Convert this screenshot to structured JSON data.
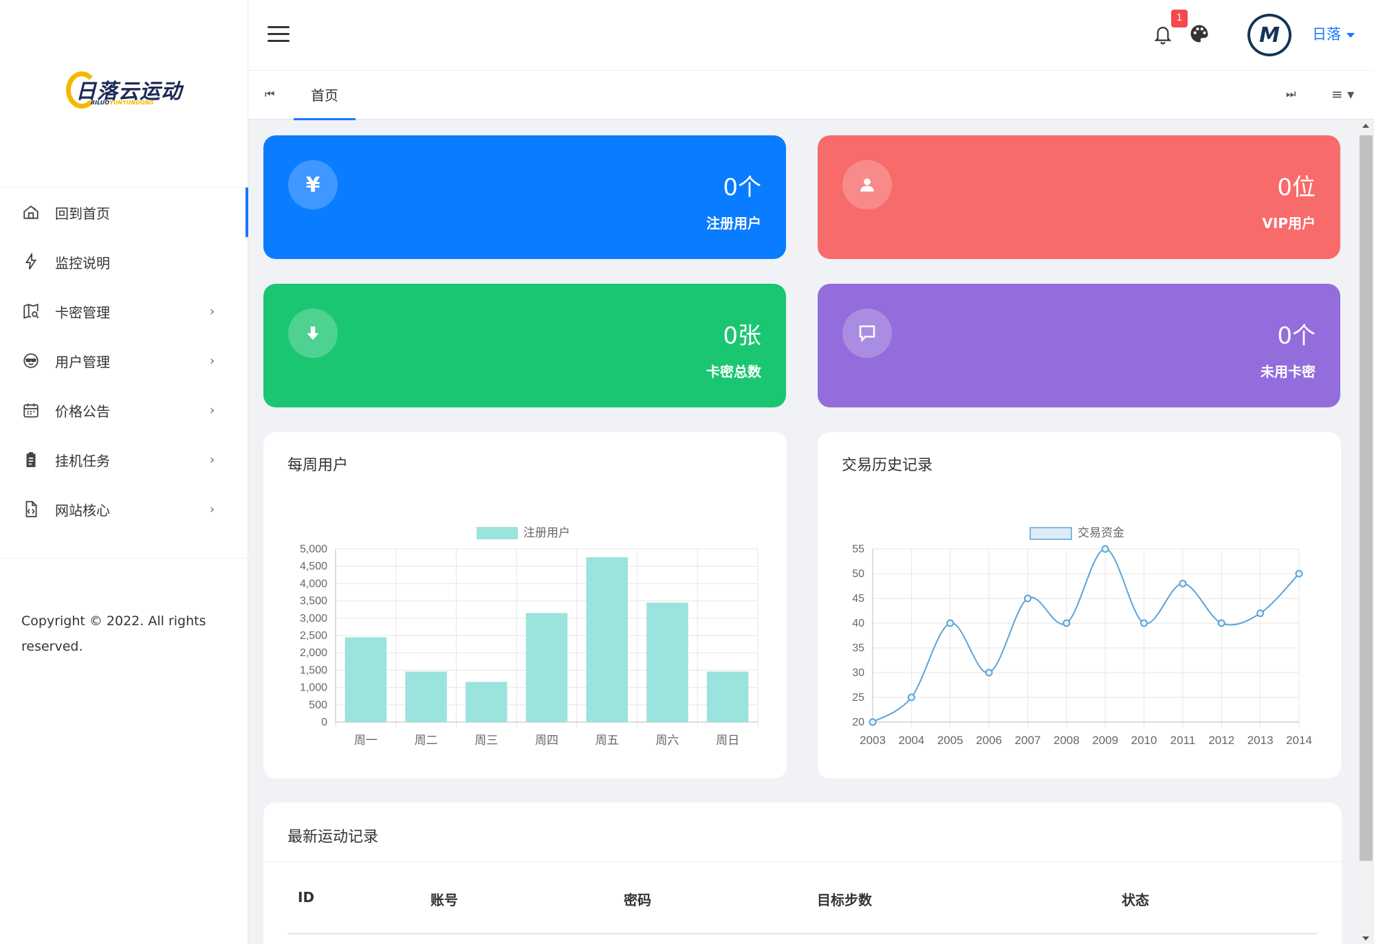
{
  "brand": {
    "logo_text": "日落云运动",
    "logo_sub_a": "RILUO",
    "logo_sub_b": "YUNYUNDONG",
    "accent": "#1677ff",
    "logo_color": "#f5b800"
  },
  "sidebar": {
    "items": [
      {
        "label": "回到首页",
        "icon": "home-icon",
        "has_chevron": false,
        "active": true
      },
      {
        "label": "监控说明",
        "icon": "bolt-icon",
        "has_chevron": false
      },
      {
        "label": "卡密管理",
        "icon": "map-search-icon",
        "has_chevron": true
      },
      {
        "label": "用户管理",
        "icon": "sunglasses-face-icon",
        "has_chevron": true
      },
      {
        "label": "价格公告",
        "icon": "calendar-icon",
        "has_chevron": true
      },
      {
        "label": "挂机任务",
        "icon": "clipboard-icon",
        "has_chevron": true
      },
      {
        "label": "网站核心",
        "icon": "code-file-icon",
        "has_chevron": true
      }
    ],
    "chevron": "›",
    "copyright": "Copyright © 2022. All rights reserved."
  },
  "header": {
    "menu_icon": "hamburger-icon",
    "notification_count": "1",
    "username": "日落",
    "avatar_text": "M"
  },
  "tabs": {
    "prev_icon": "⏮",
    "next_icon": "⏭",
    "menu_icon": "≡ ▾",
    "items": [
      {
        "label": "首页",
        "active": true
      }
    ]
  },
  "stats": [
    {
      "value": "0个",
      "label": "注册用户",
      "icon": "yen-icon",
      "glyph": "¥",
      "color": "#0a7cff"
    },
    {
      "value": "0位",
      "label": "VIP用户",
      "icon": "user-icon",
      "glyph": "",
      "color": "#f76b6a"
    },
    {
      "value": "0张",
      "label": "卡密总数",
      "icon": "download-arrow-icon",
      "glyph": "",
      "color": "#1bc673"
    },
    {
      "value": "0个",
      "label": "未用卡密",
      "icon": "message-icon",
      "glyph": "",
      "color": "#936ddc"
    }
  ],
  "charts": {
    "weekly_title": "每周用户",
    "history_title": "交易历史记录"
  },
  "chart_data": [
    {
      "type": "bar",
      "title": "每周用户",
      "categories": [
        "周一",
        "周二",
        "周三",
        "周四",
        "周五",
        "周六",
        "周日"
      ],
      "series": [
        {
          "name": "注册用户",
          "values": [
            2450,
            1460,
            1160,
            3150,
            4760,
            3450,
            1460
          ],
          "color": "#9be3dd"
        }
      ],
      "yticks": [
        "0",
        "500",
        "1,000",
        "1,500",
        "2,000",
        "2,500",
        "3,000",
        "3,500",
        "4,000",
        "4,500",
        "5,000"
      ],
      "ylim": [
        0,
        5000
      ],
      "grid": true,
      "legend": "top-center"
    },
    {
      "type": "line",
      "title": "交易历史记录",
      "x": [
        "2003",
        "2004",
        "2005",
        "2006",
        "2007",
        "2008",
        "2009",
        "2010",
        "2011",
        "2012",
        "2013",
        "2014"
      ],
      "series": [
        {
          "name": "交易资金",
          "values": [
            20,
            25,
            40,
            30,
            45,
            40,
            55,
            40,
            48,
            40,
            42,
            50
          ],
          "color": "#5ba3d6"
        }
      ],
      "yticks": [
        "20",
        "25",
        "30",
        "35",
        "40",
        "45",
        "50",
        "55"
      ],
      "ylim": [
        20,
        55
      ],
      "grid": true,
      "legend": "top-center"
    }
  ],
  "table": {
    "title": "最新运动记录",
    "columns": [
      "ID",
      "账号",
      "密码",
      "目标步数",
      "状态"
    ]
  }
}
